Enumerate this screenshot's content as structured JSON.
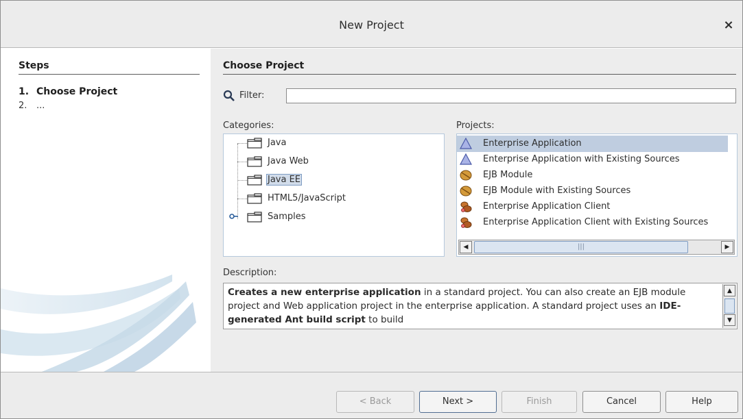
{
  "window": {
    "title": "New Project",
    "close_glyph": "×"
  },
  "steps": {
    "heading": "Steps",
    "items": [
      {
        "num": "1.",
        "label": "Choose Project",
        "current": true
      },
      {
        "num": "2.",
        "label": "...",
        "current": false
      }
    ]
  },
  "main": {
    "section_heading": "Choose Project",
    "filter": {
      "label": "Filter:",
      "value": "",
      "placeholder": ""
    },
    "categories": {
      "label": "Categories:",
      "items": [
        {
          "label": "Java",
          "selected": false,
          "expandable": false
        },
        {
          "label": "Java Web",
          "selected": false,
          "expandable": false
        },
        {
          "label": "Java EE",
          "selected": true,
          "expandable": false
        },
        {
          "label": "HTML5/JavaScript",
          "selected": false,
          "expandable": false
        },
        {
          "label": "Samples",
          "selected": false,
          "expandable": true
        }
      ]
    },
    "projects": {
      "label": "Projects:",
      "items": [
        {
          "label": "Enterprise Application",
          "icon": "triangle-icon",
          "selected": true
        },
        {
          "label": "Enterprise Application with Existing Sources",
          "icon": "triangle-icon",
          "selected": false
        },
        {
          "label": "EJB Module",
          "icon": "bean-icon",
          "selected": false
        },
        {
          "label": "EJB Module with Existing Sources",
          "icon": "bean-icon",
          "selected": false
        },
        {
          "label": "Enterprise Application Client",
          "icon": "coffee-beans-icon",
          "selected": false
        },
        {
          "label": "Enterprise Application Client with Existing Sources",
          "icon": "coffee-beans-icon",
          "selected": false
        }
      ],
      "scroll_thumb_glyph": "|||"
    },
    "description": {
      "label": "Description:",
      "bold1": "Creates a new enterprise application",
      "text1": " in a standard project. You can also create an EJB module project and Web application project in the enterprise application. A standard project uses an ",
      "bold2": "IDE-generated Ant build script",
      "text2": " to build"
    }
  },
  "buttons": {
    "back": "< Back",
    "next": "Next >",
    "finish": "Finish",
    "cancel": "Cancel",
    "help": "Help"
  },
  "colors": {
    "selection": "#bfcde0",
    "tree_selection": "#d1dcea",
    "pane_bg": "#ededed",
    "titlebar_bg": "#ececec"
  }
}
